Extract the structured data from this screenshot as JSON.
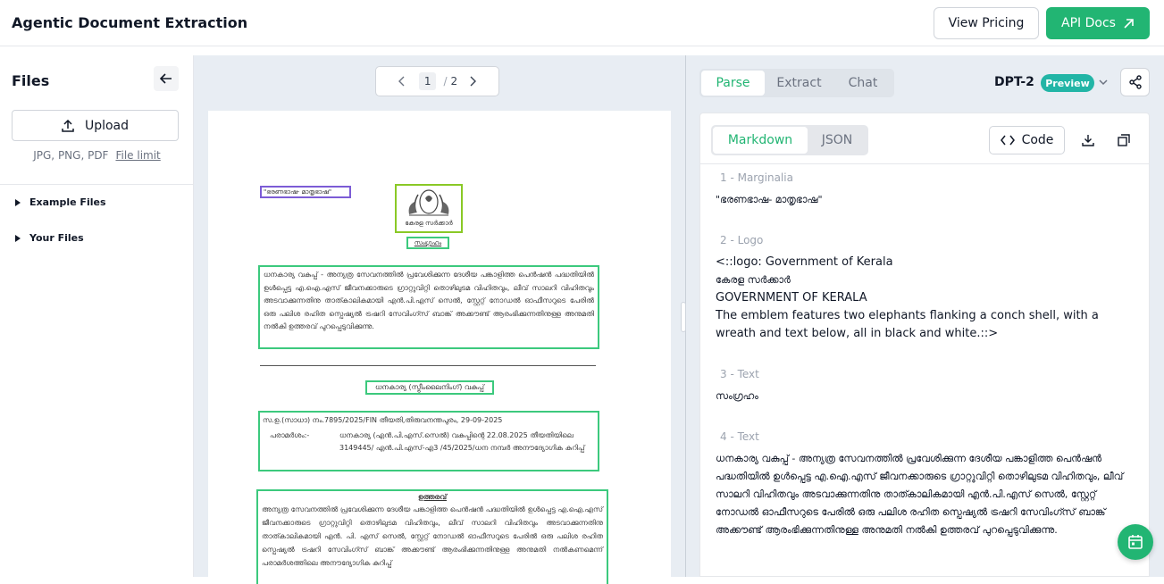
{
  "header": {
    "title": "Agentic Document Extraction",
    "pricing_label": "View Pricing",
    "api_label": "API Docs"
  },
  "sidebar": {
    "title": "Files",
    "upload_label": "Upload",
    "file_types": "JPG, PNG, PDF",
    "file_limit": "File limit",
    "tree": [
      {
        "label": "Example Files"
      },
      {
        "label": "Your Files"
      }
    ]
  },
  "viewer": {
    "page_current": "1",
    "page_sep": "/",
    "page_total": "2",
    "doc": {
      "marginalia": "\"ഭരണഭാഷ- മാതൃഭാഷ\"",
      "logo_text": "കേരള സർക്കാർ",
      "sangraham": "സംഗ്രഹം",
      "para1": "ധനകാര്യ വകുപ്പ് - അന്യത്ര സേവനത്തിൽ പ്രവേശിക്കുന്ന ദേശീയ പങ്കാളിത്ത പെൻഷൻ പദ്ധതിയിൽ ഉൾപ്പെട്ട എ.ഐ.എസ് ജീവനക്കാരുടെ ഗ്രാറ്റുവിറ്റി തൊഴിലുടമ വിഹിതവും, ലീവ് സാലറി വിഹിതവും അടവാക്കുന്നതിനു താത്കാലികമായി എൻ.പി.എസ് സെൽ, സ്റ്റേറ്റ് നോഡൽ ഓഫീസറുടെ പേരിൽ ഒരു പലിശ രഹിത സ്പെഷ്യൽ ട്രഷറി സേവിംഗ്സ് ബാങ്ക് അക്കൗണ്ട് ആരംഭിക്കുന്നതിനുള്ള അനുമതി നൽകി ഉത്തരവ് പുറപ്പെടുവിക്കുന്നു.",
      "dept": "ധനകാര്യ (സ്ട്രീംലൈനിംഗ്) വകുപ്പ്",
      "order_no": "സ.ഉ.(സാധാ) നം.7895/2025/FIN     തീയതി,തിരുവനന്തപുരം, 29-09-2025",
      "ref_label": "പരാമർശം:-",
      "ref_text": "ധനകാര്യ (എൻ.പി.എസ്.സെൽ) വകുപ്പിന്റെ 22.08.2025 തീയതിയിലെ 3149445/ എൻ.പി.എസ്-എ3 /45/2025/ധന നമ്പർ അനൗദ്യോഗിക കുറിപ്പ്",
      "order_title": "ഉത്തരവ്",
      "order_text": "അന്യത്ര സേവനത്തിൽ പ്രവേശിക്കുന്ന ദേശീയ പങ്കാളിത്ത പെൻഷൻ പദ്ധതിയിൽ ഉൾപ്പെട്ട എ.ഐ.എസ് ജീവനക്കാരുടെ ഗ്രാറ്റുവിറ്റി തൊഴിലുടമ വിഹിതവും, ലീവ് സാലറി വിഹിതവും അടവാക്കുന്നതിനു താത്കാലികമായി എൻ. പി. എസ് സെൽ, സ്റ്റേറ്റ് നോഡൽ ഓഫീസറുടെ പേരിൽ ഒരു പലിശ രഹിത സ്പെഷ്യൽ ട്രഷറി സേവിംഗ്സ് ബാങ്ക് അക്കൗണ്ട് ആരംഭിക്കുന്നതിനുള്ള അനുമതി നൽകണമെന്ന് പരാമർശത്തിലെ അനൗദ്യോഗിക കുറിപ്പ്"
    }
  },
  "panel": {
    "tabs": [
      {
        "label": "Parse",
        "active": true
      },
      {
        "label": "Extract",
        "active": false
      },
      {
        "label": "Chat",
        "active": false
      }
    ],
    "model": "DPT-2",
    "badge": "Preview",
    "formats": [
      {
        "label": "Markdown",
        "active": true
      },
      {
        "label": "JSON",
        "active": false
      }
    ],
    "code_label": "Code",
    "chunks": [
      {
        "label": "1 - Marginalia",
        "lines": [
          "\"ഭരണഭാഷ- മാതൃഭാഷ\""
        ]
      },
      {
        "label": "2 - Logo",
        "lines": [
          "<::logo: Government of Kerala",
          "കേരള സർക്കാർ",
          "GOVERNMENT OF KERALA",
          "The emblem features two elephants flanking a conch shell, with a wreath and text below, all in black and white.::>"
        ]
      },
      {
        "label": "3 - Text",
        "lines": [
          "സംഗ്രഹം"
        ]
      },
      {
        "label": "4 - Text",
        "lines": [
          "ധനകാര്യ വകുപ്പ് - അന്യത്ര സേവനത്തിൽ പ്രവേശിക്കുന്ന ദേശീയ പങ്കാളിത്ത പെൻഷൻ പദ്ധതിയിൽ ഉൾപ്പെട്ട എ.ഐ.എസ് ജീവനക്കാരുടെ ഗ്രാറ്റുവിറ്റി തൊഴിലുടമ വിഹിതവും, ലീവ് സാലറി വിഹിതവും അടവാക്കുന്നതിനു താത്കാലികമായി എൻ.പി.എസ് സെൽ, സ്റ്റേറ്റ് നോഡൽ ഓഫീസറുടെ പേരിൽ ഒരു പലിശ രഹിത സ്പെഷ്യൽ ട്രഷറി സേവിംഗ്സ് ബാങ്ക് അക്കൗണ്ട് ആരംഭിക്കുന്നതിനുള്ള അനുമതി നൽകി ഉത്തരവ് പുറപ്പെടുവിക്കുന്നു."
        ]
      }
    ]
  },
  "colors": {
    "accent": "#22b573",
    "badge": "#22b5a6",
    "box_green": "#3cc97d",
    "box_purple": "#7c5cd6"
  }
}
